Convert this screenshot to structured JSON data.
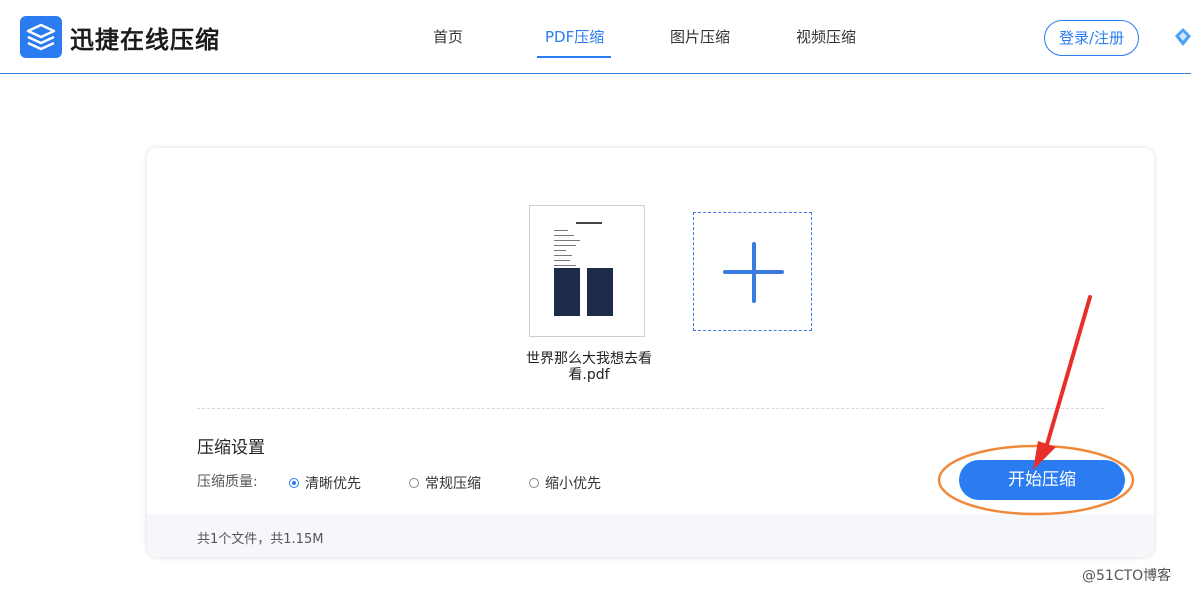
{
  "header": {
    "logo_text": "迅捷在线压缩",
    "nav": [
      {
        "label": "首页",
        "active": false
      },
      {
        "label": "PDF压缩",
        "active": true
      },
      {
        "label": "图片压缩",
        "active": false
      },
      {
        "label": "视频压缩",
        "active": false
      }
    ],
    "login_label": "登录/注册"
  },
  "upload": {
    "file_name": "世界那么大我想去看看.pdf",
    "add_icon": "plus-icon"
  },
  "settings": {
    "title": "压缩设置",
    "quality_label": "压缩质量:",
    "options": [
      {
        "label": "清晰优先",
        "checked": true
      },
      {
        "label": "常规压缩",
        "checked": false
      },
      {
        "label": "缩小优先",
        "checked": false
      }
    ],
    "start_label": "开始压缩"
  },
  "footer": {
    "summary": "共1个文件，共1.15M"
  },
  "watermark": "@51CTO博客",
  "colors": {
    "accent": "#2b7cf0",
    "annotation": "#f0893a",
    "arrow": "#e8302a"
  }
}
